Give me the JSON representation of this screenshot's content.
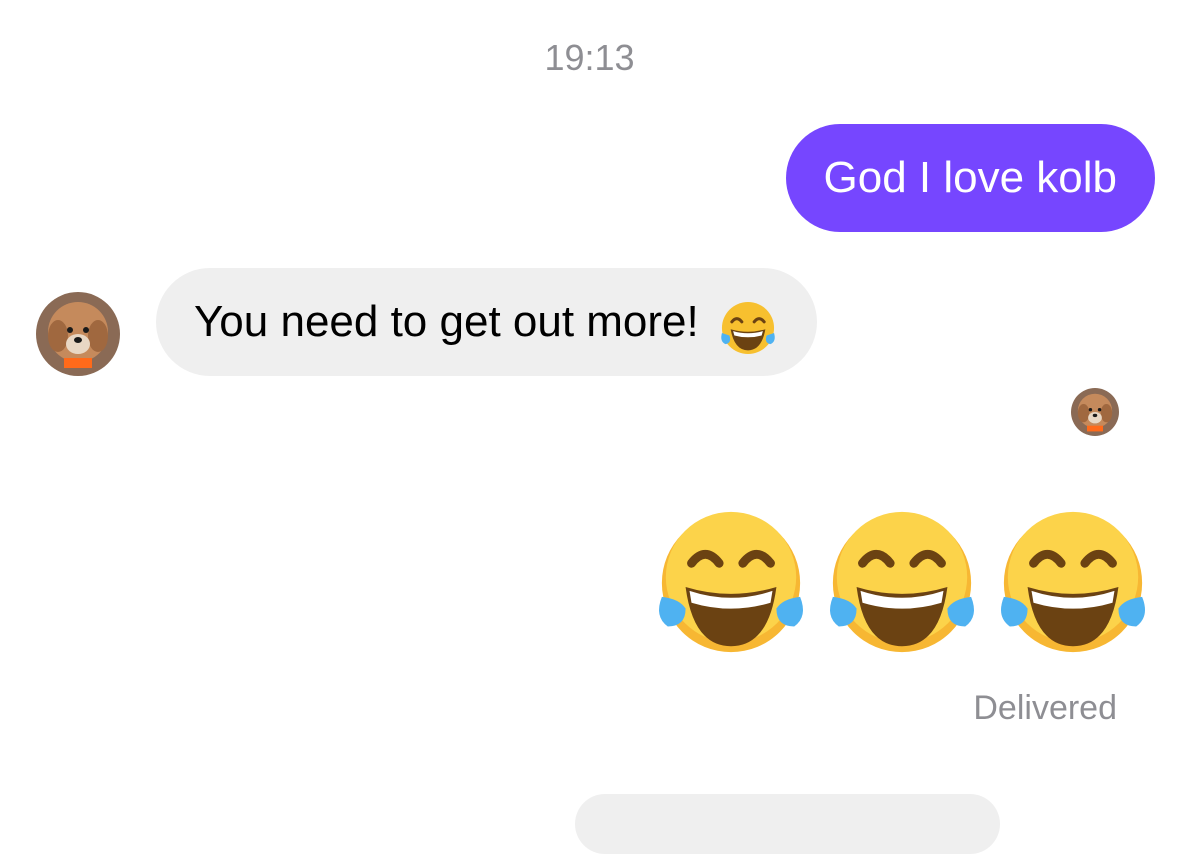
{
  "timestamp": "19:13",
  "messages": {
    "outgoing_text": "God I love kolb",
    "incoming_text": "You need to get out more!",
    "incoming_emoji": "face-with-tears-of-joy-icon",
    "outgoing_emojis": [
      "face-with-tears-of-joy-icon",
      "face-with-tears-of-joy-icon",
      "face-with-tears-of-joy-icon"
    ]
  },
  "status": "Delivered",
  "colors": {
    "outgoing_bubble": "#7646ff",
    "incoming_bubble": "#efefef",
    "timestamp_text": "#8e8e93"
  }
}
